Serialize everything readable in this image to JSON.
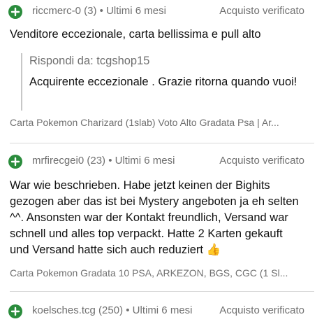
{
  "reviews": [
    {
      "username": "riccmerc-0 (3) • Ultimi 6 mesi",
      "verified": "Acquisto verificato",
      "text": "Venditore eccezionale, carta bellissima e pull alto",
      "reply": {
        "header": "Rispondi da: tcgshop15",
        "text": "Acquirente eccezionale . Grazie ritorna quando vuoi!"
      },
      "item": "Carta Pokemon Charizard (1slab) Voto Alto Gradata Psa | Ar..."
    },
    {
      "username": "mrfirecgei0 (23) • Ultimi 6 mesi",
      "verified": "Acquisto verificato",
      "text": "War wie beschrieben. Habe jetzt keinen der Bighits gezogen aber das ist bei Mystery angeboten ja eh selten ^^. Ansonsten war der Kontakt freundlich, Versand war schnell und alles top verpackt. Hatte 2 Karten gekauft und Versand hatte sich auch reduziert 👍",
      "item": "Carta Pokemon Gradata 10 PSA, ARKEZON, BGS, CGC (1 Sl..."
    },
    {
      "username": "koelsches.tcg (250) • Ultimi 6 mesi",
      "verified": "Acquisto verificato"
    }
  ],
  "colors": {
    "positive_icon": "#2a8c3c",
    "muted_text": "#707070",
    "divider": "#d9d9d9"
  },
  "icons": {
    "positive_feedback": "plus-circle-icon"
  }
}
